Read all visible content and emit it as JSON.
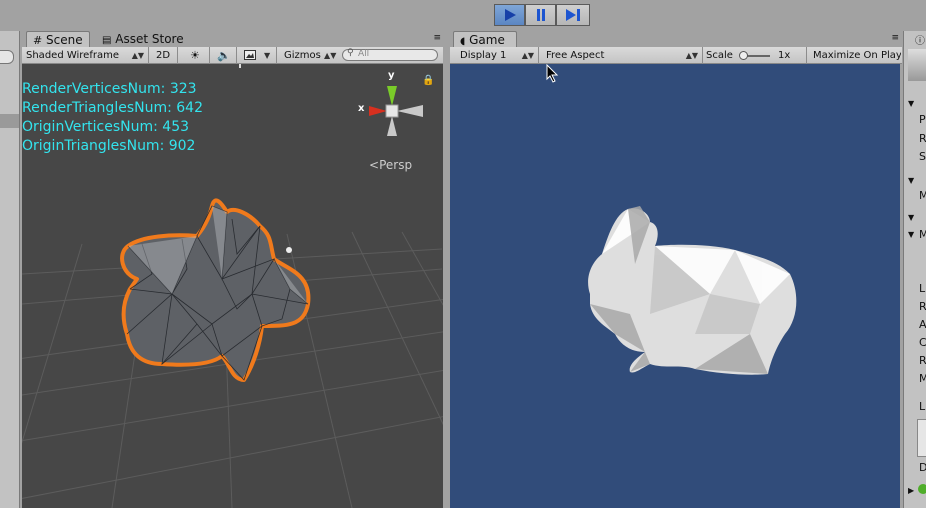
{
  "play_controls": {
    "play_icon": "play-icon",
    "pause_icon": "pause-icon",
    "step_icon": "step-icon"
  },
  "scene_panel": {
    "tab_label": "Scene",
    "asset_store_label": "Asset Store",
    "shading_mode": "Shaded Wireframe",
    "mode_2d_label": "2D",
    "gizmos_label": "Gizmos",
    "search_placeholder": "All",
    "stats": [
      "RenderVerticesNum: 323",
      "RenderTrianglesNum: 642",
      "OriginVerticesNum: 453",
      "OriginTrianglesNum: 902"
    ],
    "persp_label": "Persp",
    "gizmo_axes": {
      "y": "y",
      "x": "x"
    },
    "colors": {
      "stats_text": "#33e4ee",
      "selection_outline": "#f07a1c",
      "background": "#474747"
    }
  },
  "game_panel": {
    "tab_label": "Game",
    "display": "Display 1",
    "aspect": "Free Aspect",
    "scale_label": "Scale",
    "scale_value": "1x",
    "maximize_label": "Maximize On Play",
    "colors": {
      "background": "#314c7a"
    }
  },
  "inspector": {
    "letters": [
      "P",
      "R",
      "S",
      "M",
      "M",
      "L",
      "R",
      "A",
      "C",
      "R",
      "M",
      "L",
      "D"
    ]
  }
}
